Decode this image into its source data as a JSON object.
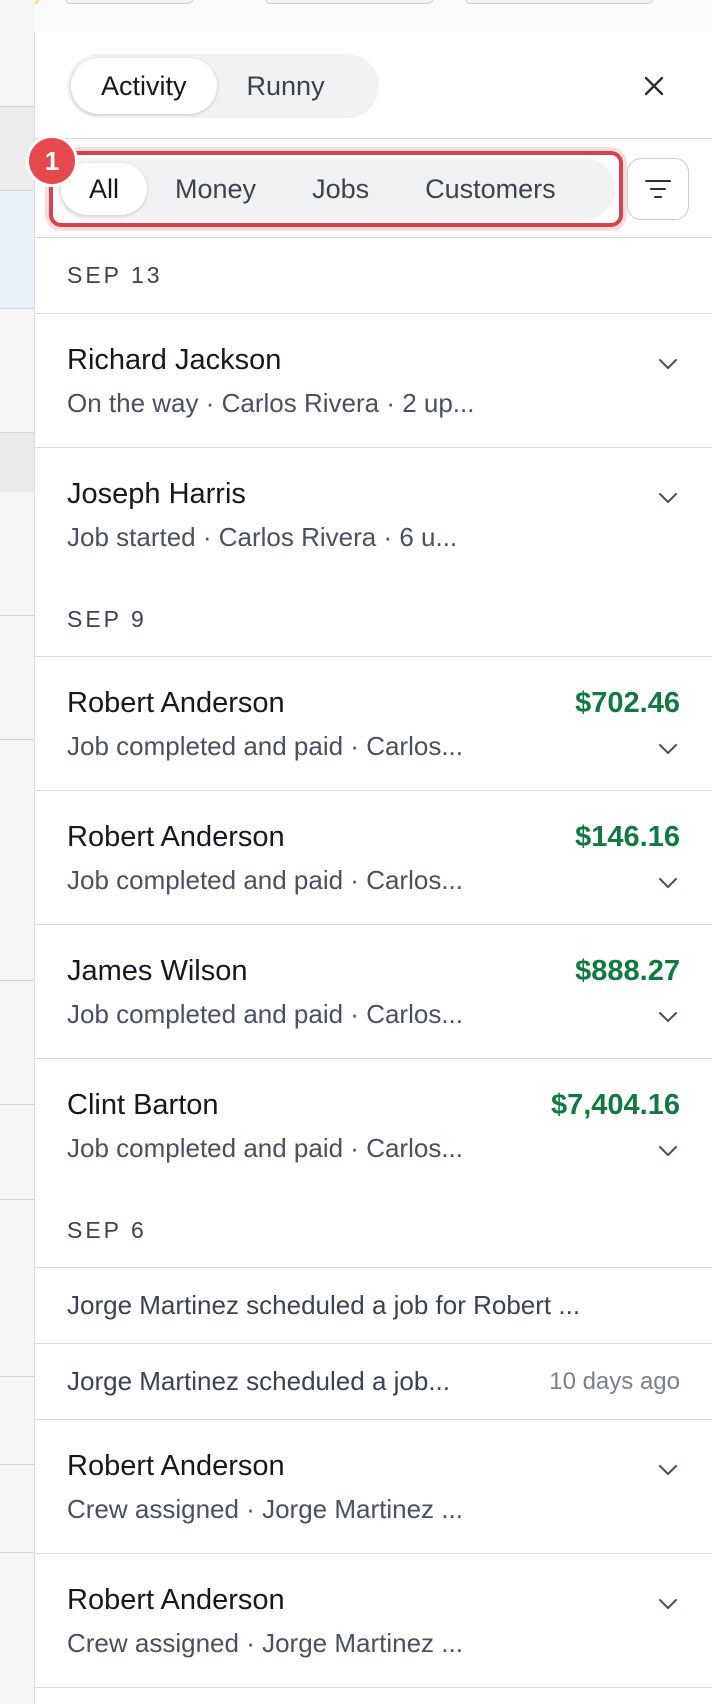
{
  "header": {
    "tabs": [
      {
        "label": "Activity",
        "active": true
      },
      {
        "label": "Runny",
        "active": false
      }
    ],
    "close_icon": "close-icon"
  },
  "filters": {
    "badge": "1",
    "tabs": [
      {
        "label": "All",
        "active": true
      },
      {
        "label": "Money",
        "active": false
      },
      {
        "label": "Jobs",
        "active": false
      },
      {
        "label": "Customers",
        "active": false
      }
    ],
    "filter_icon": "filter-icon",
    "highlight_color": "#d8434e"
  },
  "groups": [
    {
      "date": "SEP 13",
      "items": [
        {
          "name": "Richard Jackson",
          "sub": "On the way · Carlos Rivera · 2 up...",
          "amount": ""
        },
        {
          "name": "Joseph Harris",
          "sub": "Job started · Carlos Rivera · 6 u...",
          "amount": ""
        }
      ]
    },
    {
      "date": "SEP 9",
      "items": [
        {
          "name": "Robert Anderson",
          "sub": "Job completed and paid · Carlos...",
          "amount": "$702.46"
        },
        {
          "name": "Robert Anderson",
          "sub": "Job completed and paid · Carlos...",
          "amount": "$146.16"
        },
        {
          "name": "James Wilson",
          "sub": "Job completed and paid · Carlos...",
          "amount": "$888.27"
        },
        {
          "name": "Clint Barton",
          "sub": "Job completed and paid · Carlos...",
          "amount": "$7,404.16"
        }
      ]
    },
    {
      "date": "SEP 6",
      "simple": [
        {
          "text": "Jorge Martinez scheduled a job for Robert ...",
          "ago": ""
        },
        {
          "text": "Jorge Martinez scheduled a job...",
          "ago": "10 days ago"
        }
      ],
      "items": [
        {
          "name": "Robert Anderson",
          "sub": "Crew assigned · Jorge Martinez ...",
          "amount": ""
        },
        {
          "name": "Robert Anderson",
          "sub": "Crew assigned · Jorge Martinez ...",
          "amount": ""
        }
      ]
    }
  ],
  "colors": {
    "money": "#137a3f",
    "badge": "#e5484d"
  }
}
